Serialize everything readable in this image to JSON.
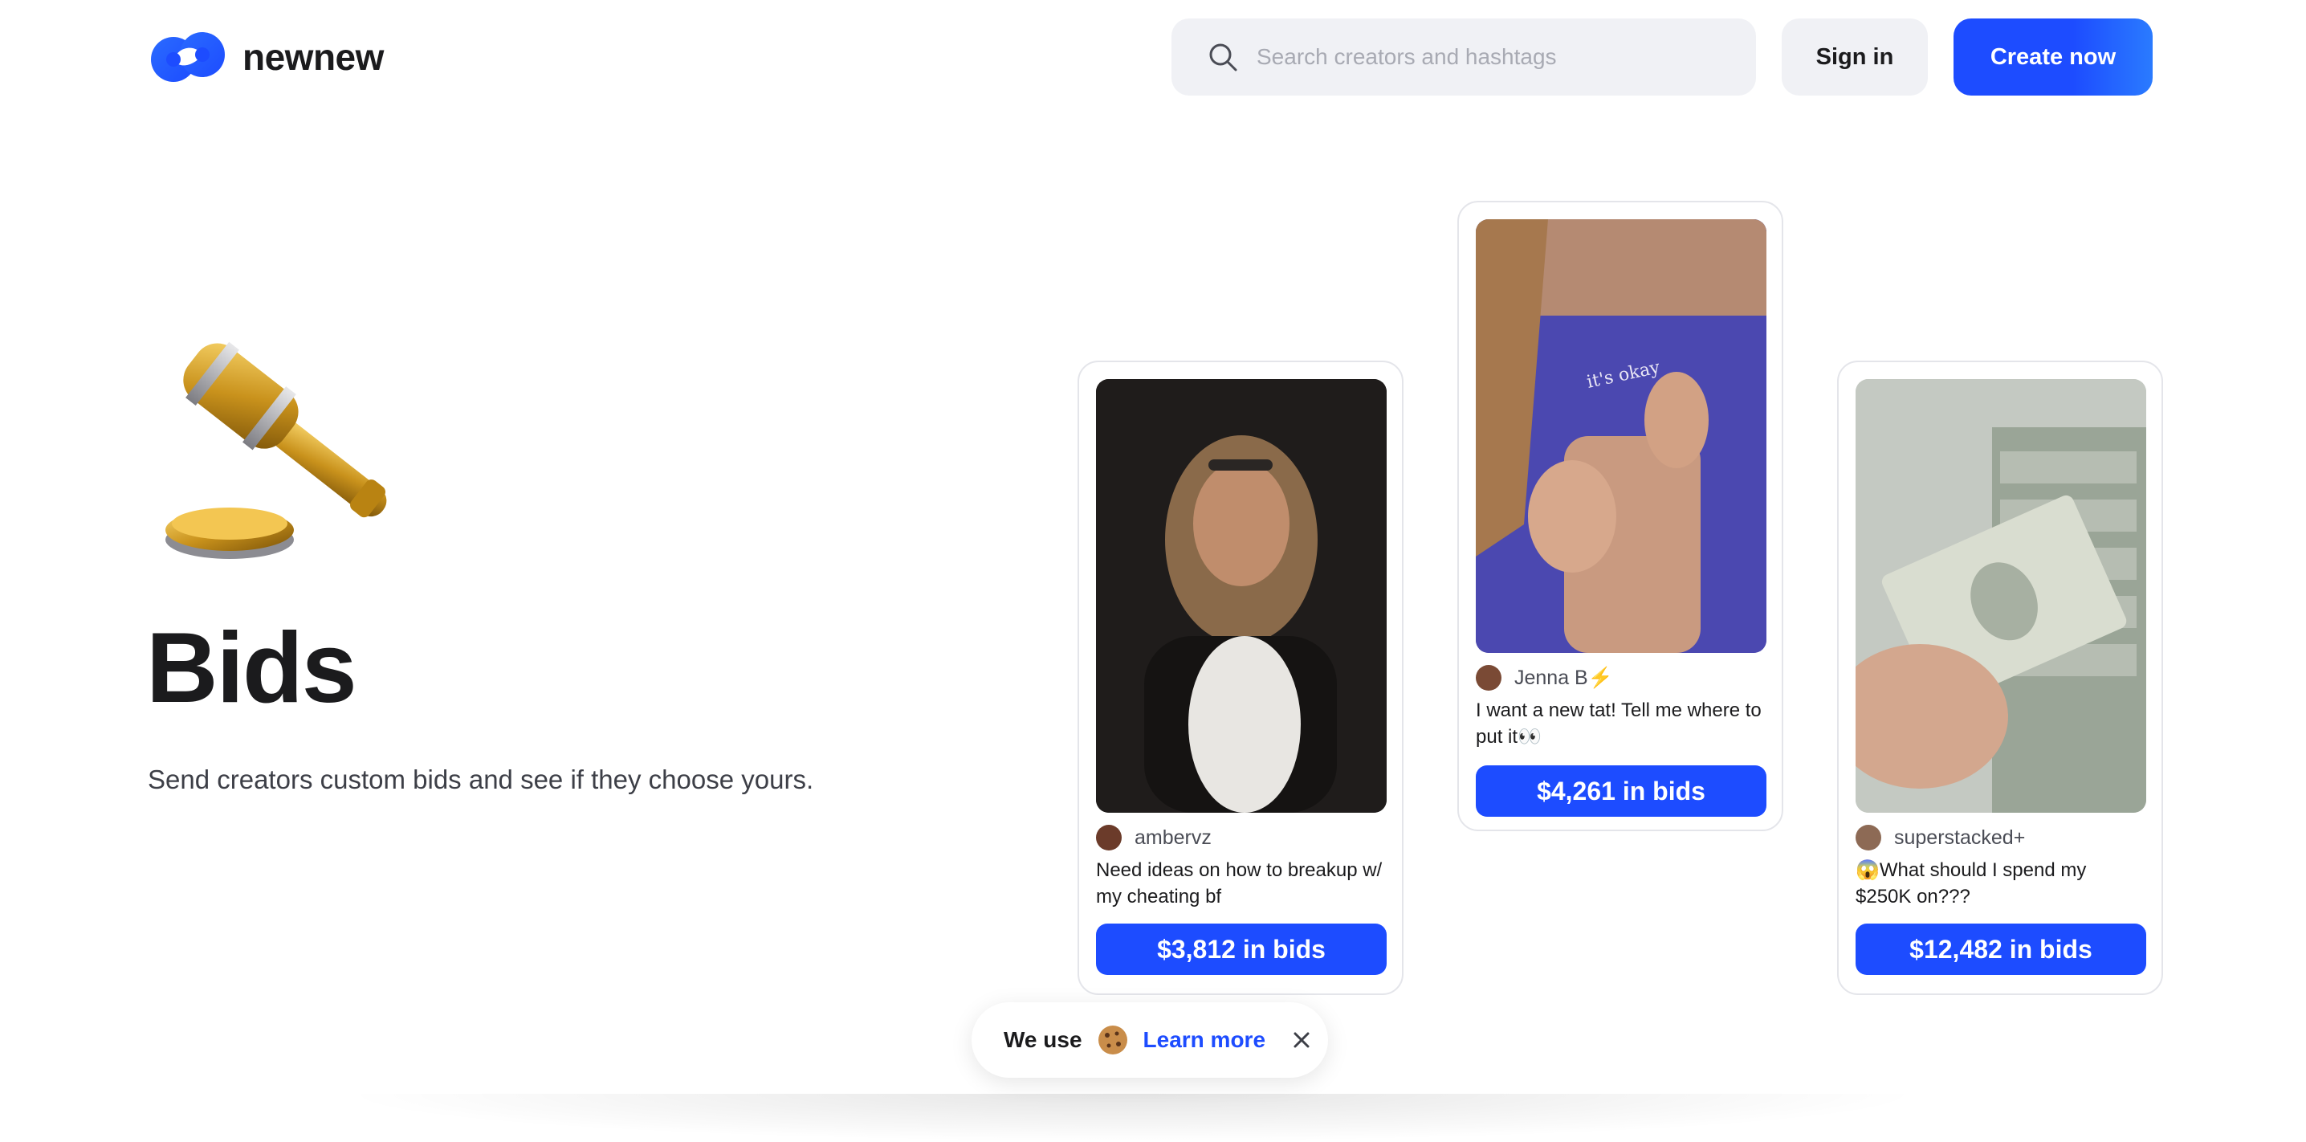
{
  "header": {
    "brand": "newnew",
    "search_placeholder": "Search creators and hashtags",
    "sign_in": "Sign in",
    "create_now": "Create now"
  },
  "hero": {
    "title": "Bids",
    "subtitle": "Send creators custom bids and see if they choose yours."
  },
  "cards": [
    {
      "creator": "ambervz",
      "caption": "Need ideas on how to breakup w/ my cheating bf",
      "bids": "$3,812 in bids"
    },
    {
      "creator": "Jenna B⚡",
      "caption": "I want a new tat! Tell me where to put it👀",
      "bids": "$4,261 in bids"
    },
    {
      "creator": "superstacked+",
      "caption": "😱What should I spend my $250K on???",
      "bids": "$12,482 in bids"
    }
  ],
  "cookie_banner": {
    "text": "We use",
    "link": "Learn more"
  },
  "colors": {
    "accent": "#1d4cff",
    "surface": "#f0f1f5"
  }
}
